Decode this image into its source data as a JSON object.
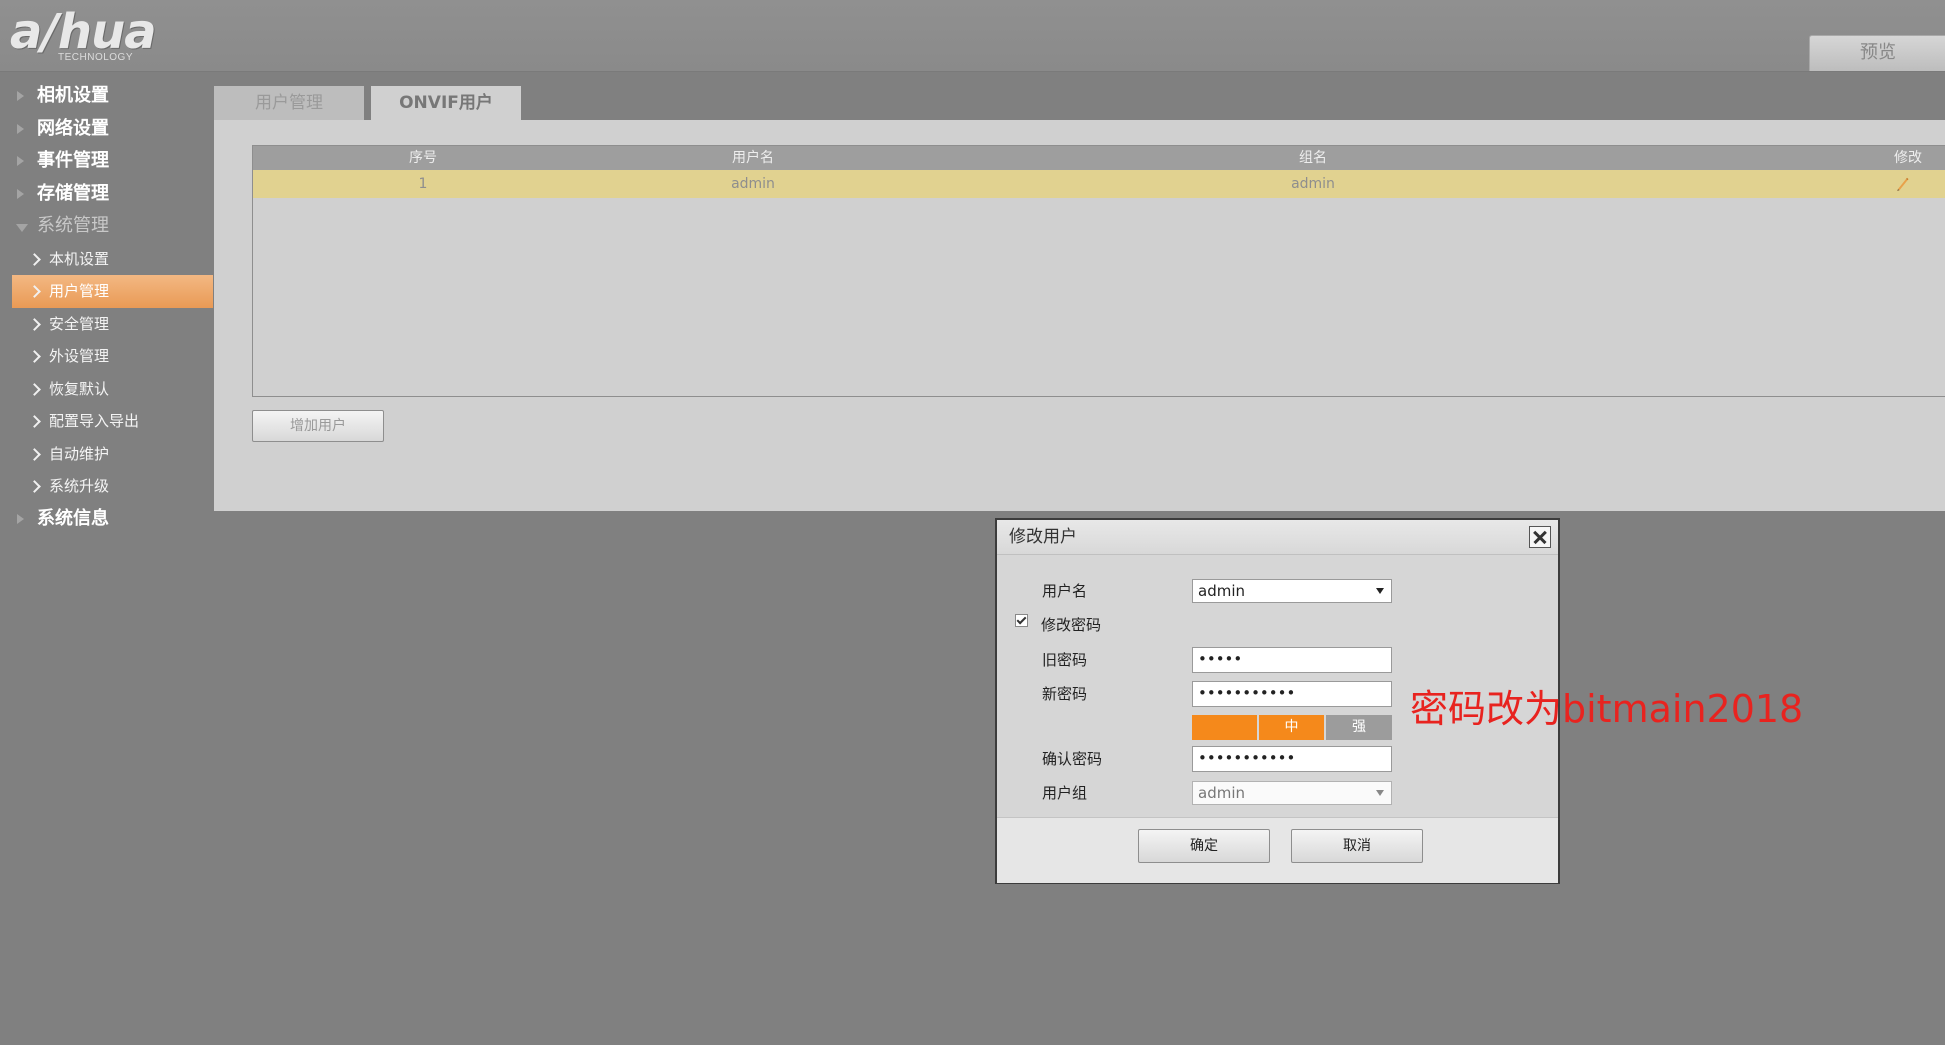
{
  "header": {
    "logo_text": "a/hua",
    "logo_subtext": "TECHNOLOGY",
    "preview_tab": "预览"
  },
  "sidebar": {
    "items": [
      {
        "label": "相机设置"
      },
      {
        "label": "网络设置"
      },
      {
        "label": "事件管理"
      },
      {
        "label": "存储管理"
      },
      {
        "label": "系统管理"
      },
      {
        "label": "系统信息"
      }
    ],
    "sub_items": [
      {
        "label": "本机设置"
      },
      {
        "label": "用户管理"
      },
      {
        "label": "安全管理"
      },
      {
        "label": "外设管理"
      },
      {
        "label": "恢复默认"
      },
      {
        "label": "配置导入导出"
      },
      {
        "label": "自动维护"
      },
      {
        "label": "系统升级"
      }
    ]
  },
  "tabs": [
    {
      "label": "用户管理"
    },
    {
      "label": "ONVIF用户"
    }
  ],
  "table": {
    "columns": [
      "序号",
      "用户名",
      "组名",
      "修改"
    ],
    "rows": [
      {
        "index": "1",
        "username": "admin",
        "group": "admin"
      }
    ]
  },
  "add_user_button": "增加用户",
  "dialog": {
    "title": "修改用户",
    "username_label": "用户名",
    "username_value": "admin",
    "change_password_label": "修改密码",
    "change_password_checked": true,
    "old_password_label": "旧密码",
    "old_password_value": "•••••",
    "new_password_label": "新密码",
    "new_password_value": "•••••••••••",
    "strength_labels": [
      "",
      "中",
      "强"
    ],
    "strength_level": "中",
    "confirm_password_label": "确认密码",
    "confirm_password_value": "•••••••••••",
    "group_label": "用户组",
    "group_value": "admin",
    "ok_button": "确定",
    "cancel_button": "取消"
  },
  "annotation_text": "密码改为bitmain2018",
  "colors": {
    "accent_orange": "#f5891b",
    "active_nav": "#e99a55",
    "selected_row": "#e1d290",
    "annotation_red": "#e8231f"
  }
}
